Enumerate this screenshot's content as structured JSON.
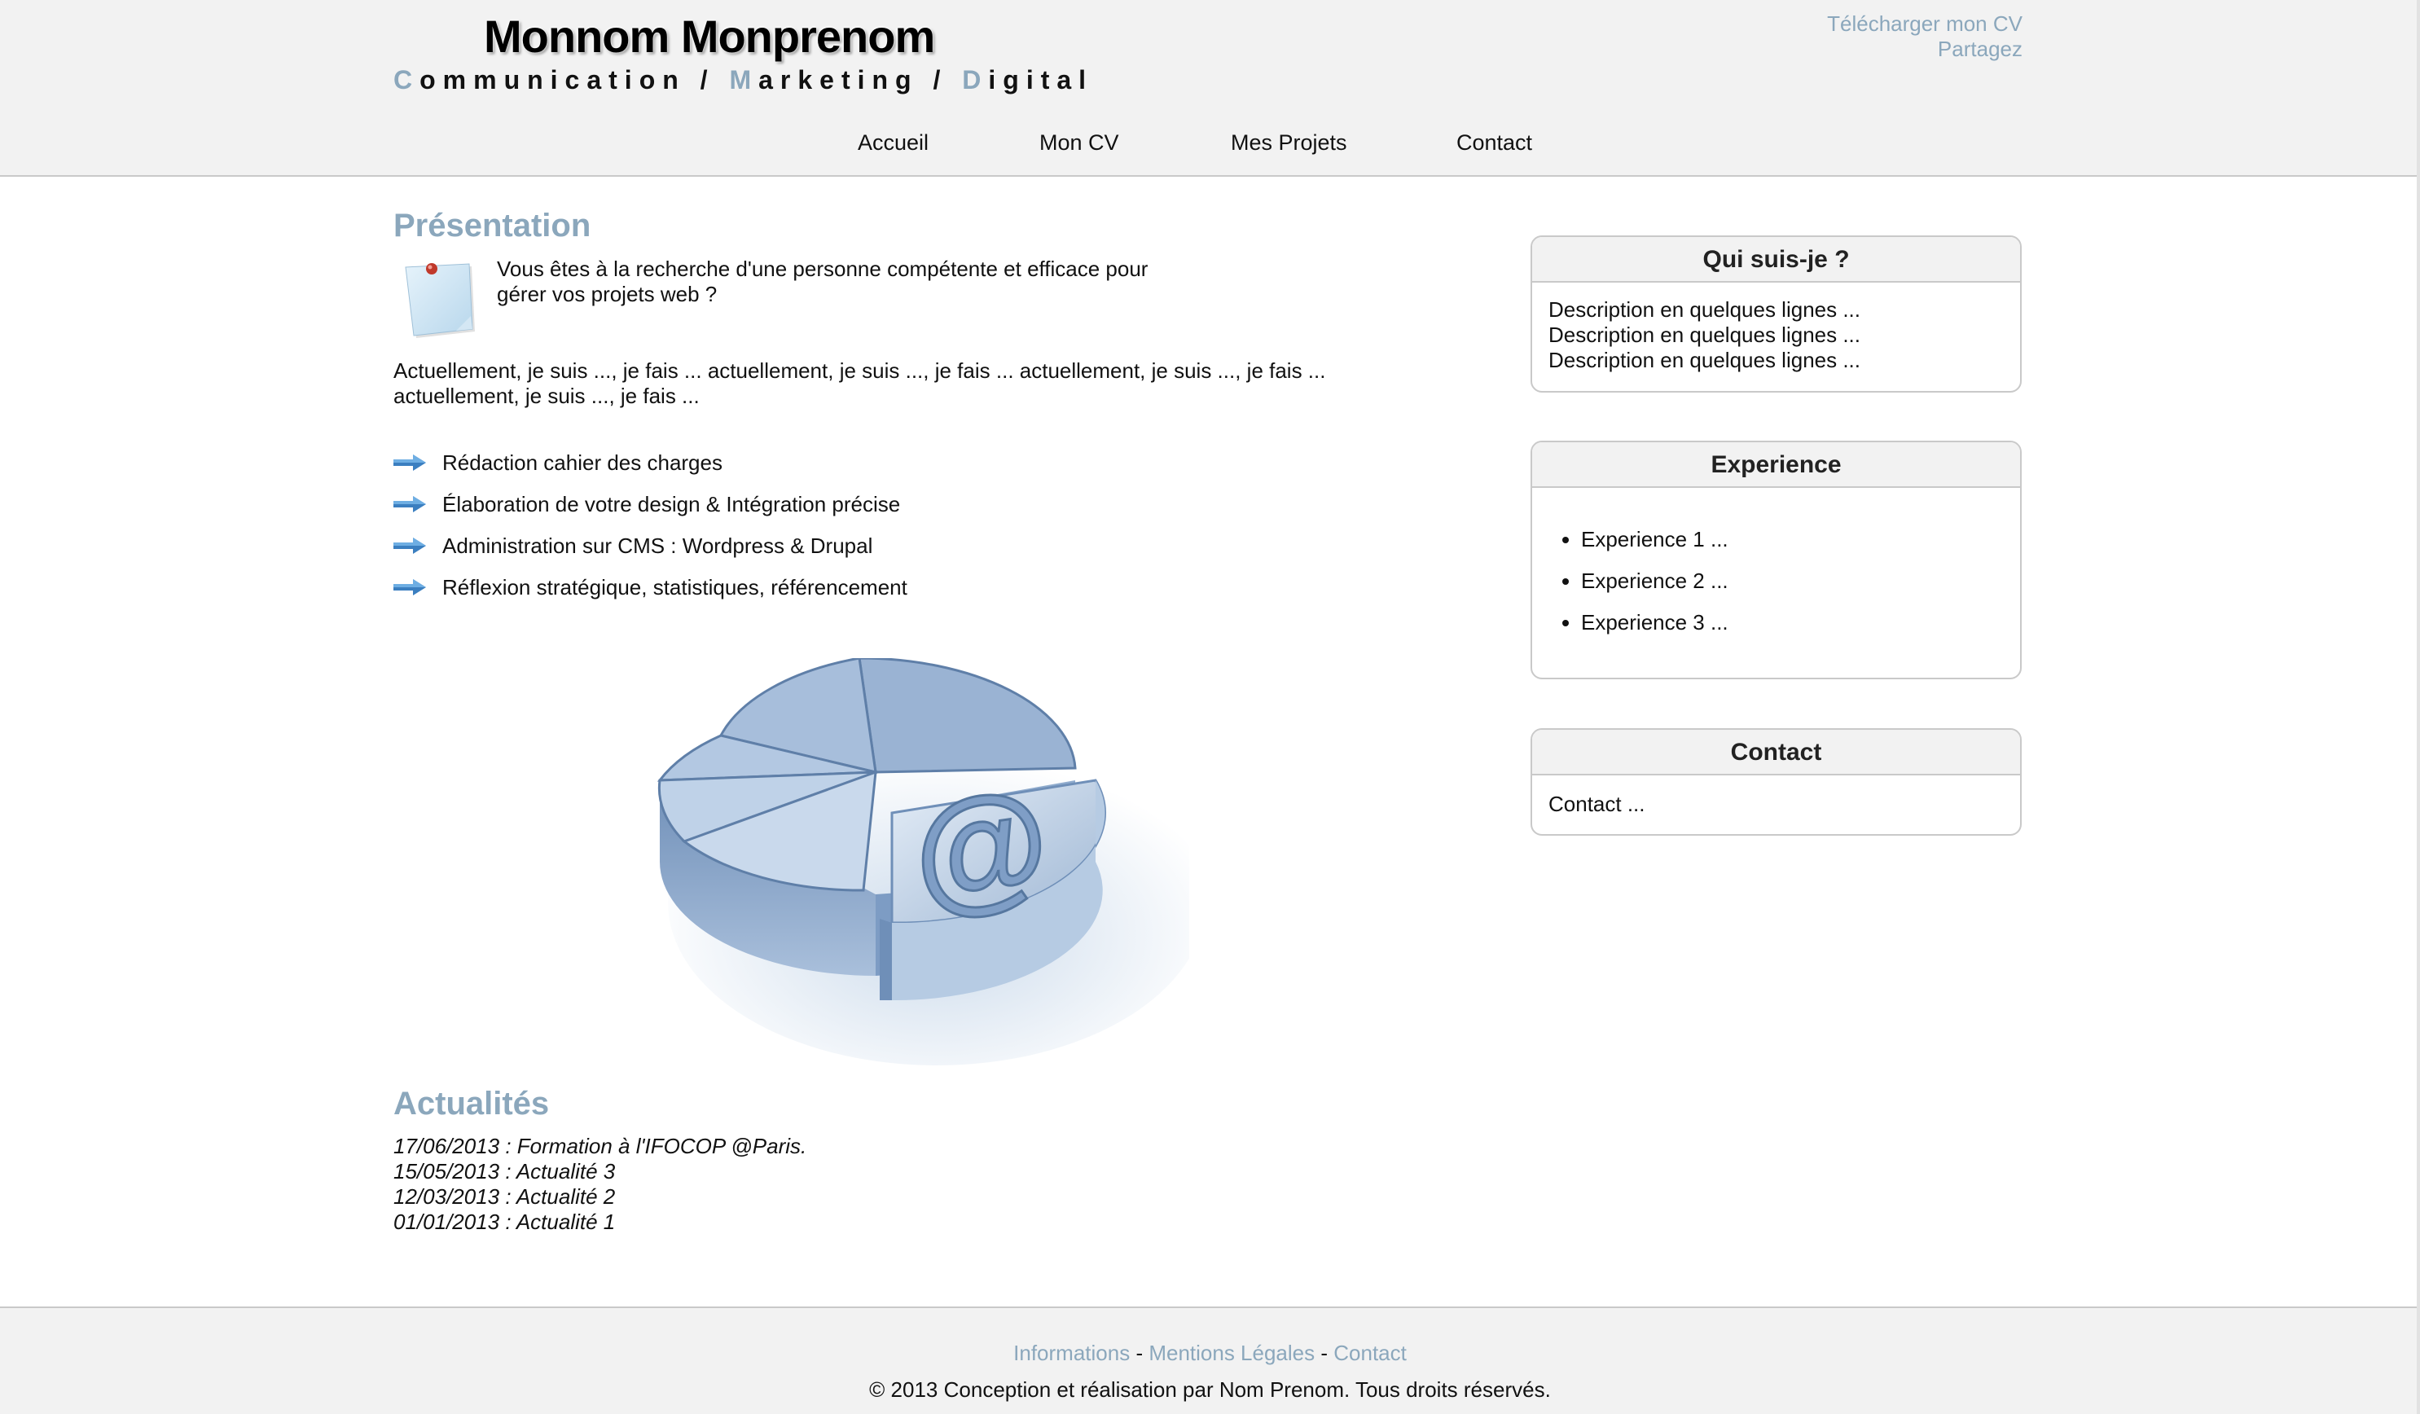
{
  "header": {
    "name": "Monnom Monprenom",
    "tagline": [
      {
        "initial": "C",
        "rest": "ommunication"
      },
      {
        "sep": " / "
      },
      {
        "initial": "M",
        "rest": "arketing"
      },
      {
        "sep": " / "
      },
      {
        "initial": "D",
        "rest": "igital"
      }
    ],
    "download_cv": "Télécharger mon CV",
    "share": "Partagez"
  },
  "nav": {
    "items": [
      {
        "label": "Accueil"
      },
      {
        "label": "Mon CV"
      },
      {
        "label": "Mes Projets"
      },
      {
        "label": "Contact"
      }
    ]
  },
  "presentation": {
    "title": "Présentation",
    "intro": "Vous êtes à la recherche d'une personne compétente et efficace pour gérer vos projets web ?",
    "body": "Actuellement, je suis ..., je fais ... actuellement, je suis ..., je fais ... actuellement, je suis ..., je fais ... actuellement, je suis ..., je fais ...",
    "services": [
      {
        "label": "Rédaction cahier des charges"
      },
      {
        "label": "Élaboration de votre design & Intégration précise"
      },
      {
        "label": "Administration sur CMS : Wordpress & Drupal"
      },
      {
        "label": "Réflexion stratégique, statistiques, référencement"
      }
    ],
    "illustration_glyph": "@"
  },
  "news": {
    "title": "Actualités",
    "items": [
      {
        "text": "17/06/2013 : Formation à l'IFOCOP @Paris."
      },
      {
        "text": "15/05/2013 : Actualité 3"
      },
      {
        "text": "12/03/2013 : Actualité 2"
      },
      {
        "text": "01/01/2013 : Actualité 1"
      }
    ]
  },
  "sidebar": {
    "about": {
      "title": "Qui suis-je ?",
      "lines": [
        "Description en quelques lignes ...",
        "Description en quelques lignes ...",
        "Description en quelques lignes ..."
      ]
    },
    "experience": {
      "title": "Experience",
      "items": [
        "Experience 1 ...",
        "Experience 2 ...",
        "Experience 3 ..."
      ]
    },
    "contact": {
      "title": "Contact",
      "text": "Contact ..."
    }
  },
  "footer": {
    "links": [
      {
        "label": "Informations"
      },
      {
        "label": "Mentions Légales"
      },
      {
        "label": "Contact"
      }
    ],
    "separator": " - ",
    "copyright": "© 2013 Conception et réalisation par Nom Prenom. Tous droits réservés."
  },
  "colors": {
    "accent": "#8ba7bc",
    "header_bg": "#f2f2f2",
    "border": "#c9c9c9",
    "text": "#111111"
  },
  "icons": {
    "note": "pinned-note-icon",
    "bullet": "blue-arrow-icon",
    "illustration": "pie-chart-at-sign-illustration"
  }
}
